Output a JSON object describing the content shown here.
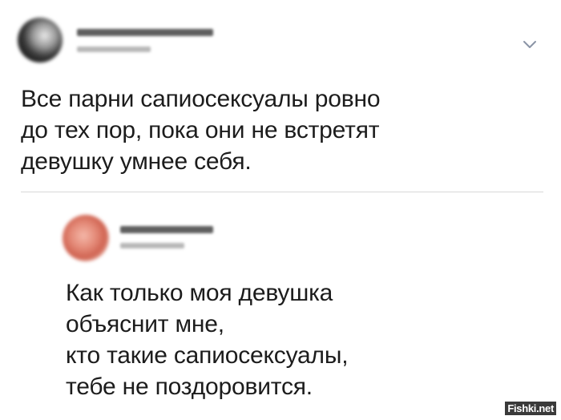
{
  "tweet": {
    "lines": [
      "Все парни сапиосексуалы ровно",
      "до тех пор, пока они не встретят",
      "девушку умнее себя."
    ],
    "menu_icon": "chevron-down-icon"
  },
  "reply": {
    "lines": [
      "Как только моя девушка",
      "объяснит мне,",
      "кто такие сапиосексуалы,",
      "тебе не поздоровится."
    ]
  },
  "watermark": {
    "text": "Fishki.net"
  },
  "colors": {
    "text": "#1c1c1c",
    "divider": "#d8d8d8",
    "chevron": "#8a94a6"
  }
}
